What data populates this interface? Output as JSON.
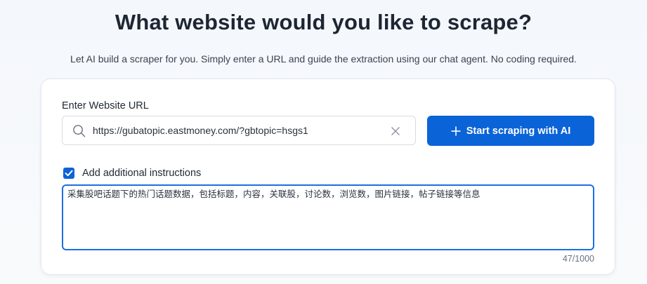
{
  "header": {
    "title": "What website would you like to scrape?",
    "subtitle": "Let AI build a scraper for you. Simply enter a URL and guide the extraction using our chat agent. No coding required."
  },
  "form": {
    "url_label": "Enter Website URL",
    "url_value": "https://gubatopic.eastmoney.com/?gbtopic=hsgs1",
    "start_button_label": "Start scraping with AI",
    "instructions_checkbox_label": "Add additional instructions",
    "instructions_checked": true,
    "instructions_value": "采集股吧话题下的热门话题数据，包括标题，内容，关联股，讨论数，浏览数，图片链接，帖子链接等信息",
    "char_count": "47/1000"
  },
  "icons": {
    "search": "search-icon",
    "clear": "close-icon",
    "plus": "plus-icon",
    "check": "checkmark-icon"
  },
  "colors": {
    "accent": "#0b63d8",
    "focus_border": "#1c6fe0"
  }
}
